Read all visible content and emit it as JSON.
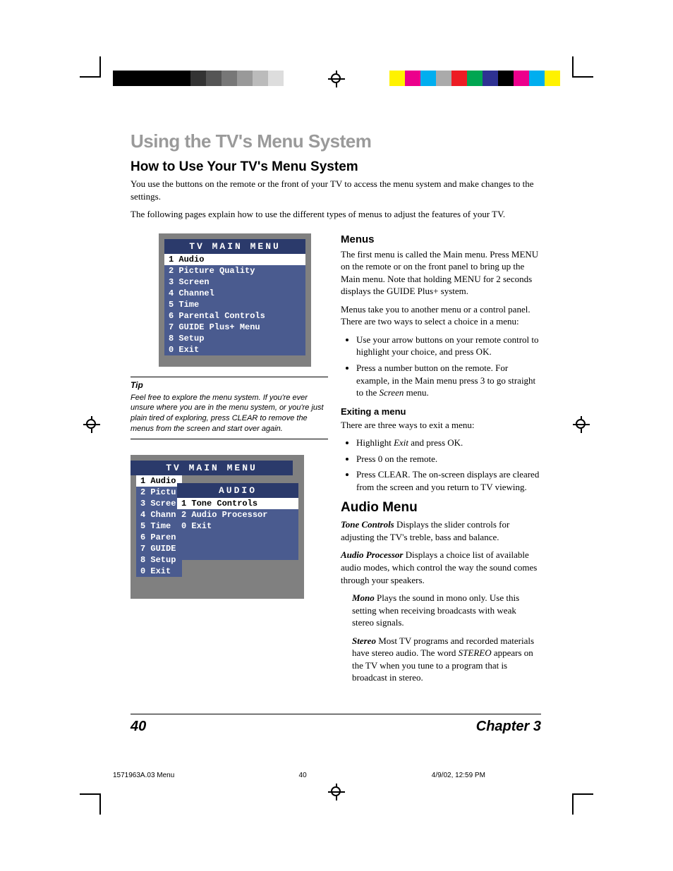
{
  "header": {
    "title": "Using the TV's Menu System",
    "subtitle": "How to Use Your TV's Menu System",
    "p1": "You use the buttons on the remote or the front of your TV to access the menu system and make changes to the settings.",
    "p2": "The following pages explain how to use the different types of menus to adjust the features of your TV."
  },
  "mainMenu": {
    "title": "TV MAIN MENU",
    "items": [
      "1 Audio",
      "2 Picture Quality",
      "3 Screen",
      "4 Channel",
      "5 Time",
      "6 Parental Controls",
      "7 GUIDE Plus+ Menu",
      "8 Setup",
      "0 Exit"
    ]
  },
  "tip": {
    "head": "Tip",
    "text": "Feel free to explore the menu system. If you're ever unsure where you are in the menu system, or you're just plain tired of exploring, press CLEAR to remove the menus from the screen and start over again."
  },
  "nestedMenu": {
    "title": "TV MAIN MENU",
    "backItems": [
      "1 Audio",
      "2 Pictu",
      "3 Scree",
      "4 Chann",
      "5 Time",
      "6 Paren",
      "7 GUIDE",
      "8 Setup",
      "0 Exit"
    ],
    "audioTitle": "AUDIO",
    "audioItems": [
      "1 Tone Controls",
      "2 Audio Processor",
      "0 Exit"
    ]
  },
  "right": {
    "menusHead": "Menus",
    "menusP1": "The first menu is called the Main menu. Press MENU on the remote or on the front panel to bring up the Main menu. Note that holding MENU for 2 seconds displays the GUIDE Plus+ system.",
    "menusP2": "Menus take you to another menu or a control panel. There are two ways to select a choice in a menu:",
    "menusLi1": "Use your arrow buttons on your remote control to highlight your choice, and press OK.",
    "menusLi2a": "Press a number button on the remote. For example, in the Main menu press 3 to go straight to the ",
    "menusLi2i": "Screen",
    "menusLi2b": " menu.",
    "exitHead": "Exiting a menu",
    "exitP": "There are three ways to exit a menu:",
    "exitLi1a": "Highlight ",
    "exitLi1i": "Exit",
    "exitLi1b": " and press OK.",
    "exitLi2": "Press 0 on the remote.",
    "exitLi3": "Press CLEAR. The on-screen displays are cleared from the screen and you return to TV viewing.",
    "audioHead": "Audio Menu",
    "toneBold": "Tone Controls",
    "toneText": "   Displays the slider controls for adjusting the TV's treble, bass and balance.",
    "apBold": "Audio Processor",
    "apText": "   Displays a choice list of available audio modes, which control the way the sound comes through your speakers.",
    "monoBold": "Mono",
    "monoText": "   Plays the sound in mono only. Use this setting when receiving broadcasts with weak stereo signals.",
    "stereoBold": "Stereo",
    "stereoTextA": "   Most TV programs and recorded materials have stereo audio. The word ",
    "stereoItalic": "STEREO",
    "stereoTextB": " appears on the TV when you tune to a program that is broadcast in stereo."
  },
  "footer": {
    "page": "40",
    "chapter": "Chapter 3"
  },
  "meta": {
    "file": "1571963A.03 Menu",
    "pg": "40",
    "date": "4/9/02, 12:59 PM"
  },
  "colorBars": {
    "left": [
      "#000",
      "#000",
      "#000",
      "#000",
      "#000",
      "#333",
      "#555",
      "#777",
      "#999",
      "#bbb",
      "#ddd"
    ],
    "right": [
      "#fff200",
      "#ec008c",
      "#00aeef",
      "#aaa",
      "#ed1c24",
      "#00a651",
      "#2e3192",
      "#000",
      "#ec008c",
      "#00aeef",
      "#fff200"
    ]
  }
}
